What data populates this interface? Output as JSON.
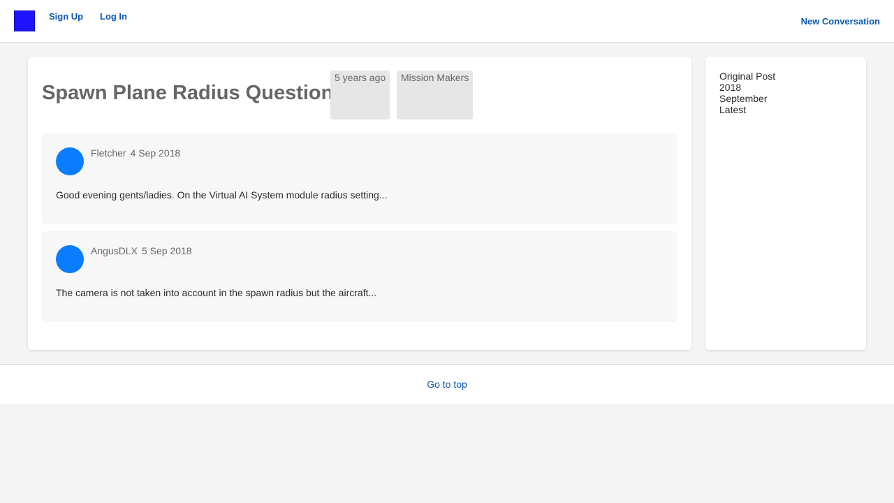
{
  "header": {
    "logo_icon": "site-logo-icon",
    "signup_label": "Sign Up",
    "login_label": "Log In",
    "new_conversation_label": "New Conversation"
  },
  "discussion": {
    "title": "Spawn Plane Radius Question",
    "age_tag": "5 years ago",
    "category_tag": "Mission Makers"
  },
  "posts": [
    {
      "author": "Fletcher",
      "date": "4 Sep 2018",
      "body": "Good evening gents/ladies. On the Virtual AI System module radius setting...",
      "avatar_icon": "avatar-icon"
    },
    {
      "author": "AngusDLX",
      "date": "5 Sep 2018",
      "body": "The camera is not taken into account in the spawn radius but the aircraft...",
      "avatar_icon": "avatar-icon"
    }
  ],
  "scrubber": {
    "items": [
      "Original Post",
      "2018",
      "September",
      "Latest"
    ]
  },
  "footer": {
    "go_top_label": "Go to top"
  },
  "colors": {
    "logo": "#1f14ff",
    "link": "#0a58b4",
    "avatar": "#0a7cff",
    "background": "#f4f4f4",
    "tag_background": "#e6e6e6",
    "post_background": "#f7f7f7",
    "title": "#666666"
  }
}
